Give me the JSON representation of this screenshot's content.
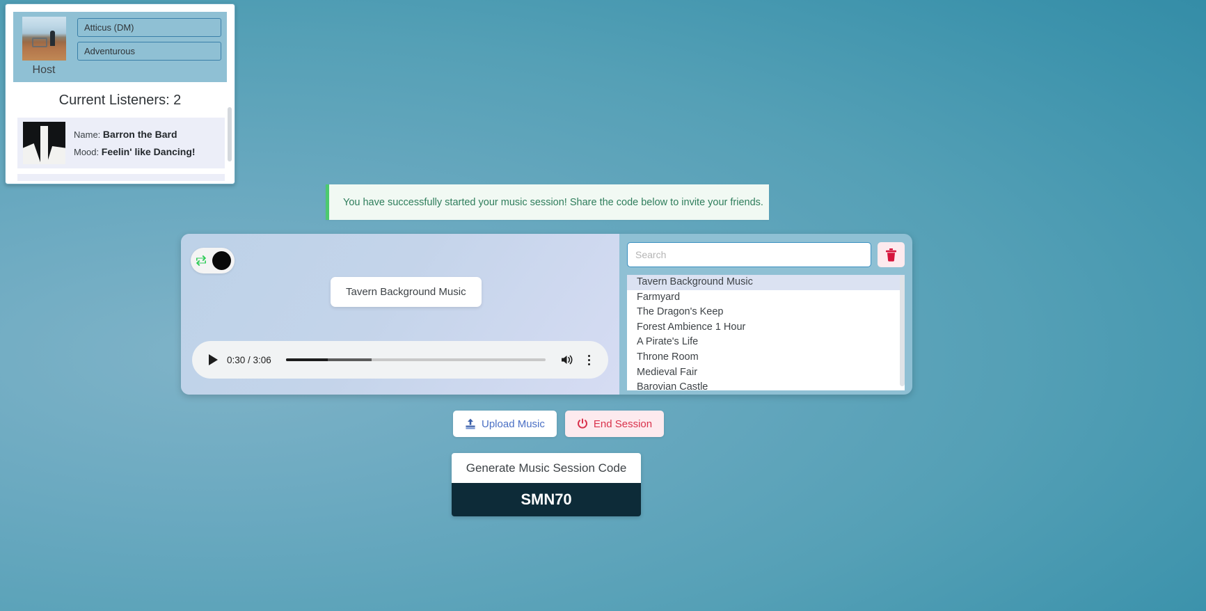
{
  "host_panel": {
    "avatar_icon": "host-photo-beach",
    "host_label": "Host",
    "name_value": "Atticus (DM)",
    "mood_value": "Adventurous",
    "listeners_heading": "Current Listeners: 2",
    "listeners": [
      {
        "avatar_icon": "listener-photo-abstract",
        "name_label": "Name:",
        "name_value": "Barron the Bard",
        "mood_label": "Mood:",
        "mood_value": "Feelin' like Dancing!"
      }
    ]
  },
  "banner": {
    "message": "You have successfully started your music session! Share the code below to invite your friends.",
    "accent_color": "#4cc96f",
    "background_color": "#f1f9f3",
    "text_color": "#2e7d5b"
  },
  "player": {
    "loop_toggle": {
      "icon": "repeat-icon",
      "icon_color": "#2ecc57",
      "state": "on"
    },
    "track_title": "Tavern Background Music",
    "audio": {
      "play_icon": "play-icon",
      "time_display": "0:30 / 3:06",
      "current_time": "0:30",
      "duration": "3:06",
      "progress_percent": 16,
      "buffered_percent": 33,
      "volume_icon": "volume-icon",
      "menu_icon": "more-vertical-icon"
    }
  },
  "playlist_panel": {
    "search": {
      "icon": "search-input",
      "placeholder": "Search",
      "value": ""
    },
    "delete_button": {
      "icon": "trash-icon",
      "color": "#d6143c"
    },
    "items": [
      {
        "label": "Tavern Background Music",
        "selected": true
      },
      {
        "label": "Farmyard",
        "selected": false
      },
      {
        "label": "The Dragon's Keep",
        "selected": false
      },
      {
        "label": "Forest Ambience 1 Hour",
        "selected": false
      },
      {
        "label": "A Pirate's Life",
        "selected": false
      },
      {
        "label": "Throne Room",
        "selected": false
      },
      {
        "label": "Medieval Fair",
        "selected": false
      },
      {
        "label": "Barovian Castle",
        "selected": false
      }
    ]
  },
  "actions": {
    "upload": {
      "label": "Upload Music",
      "icon": "upload-icon",
      "color": "#4a6fc4"
    },
    "end_session": {
      "label": "End Session",
      "icon": "power-icon",
      "color": "#d9314b"
    }
  },
  "session_code": {
    "generate_label": "Generate Music Session Code",
    "code": "SMN70"
  }
}
